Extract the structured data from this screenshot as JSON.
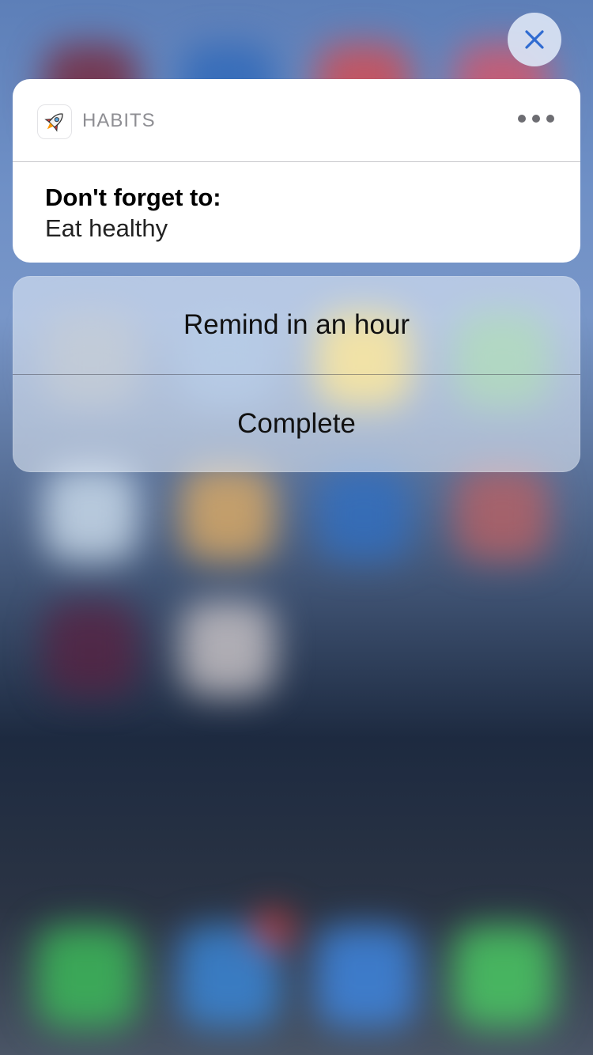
{
  "notification": {
    "app_name": "HABITS",
    "app_icon": "rocket-icon",
    "title": "Don't forget to:",
    "message": "Eat healthy"
  },
  "actions": [
    {
      "label": "Remind in an hour"
    },
    {
      "label": "Complete"
    }
  ],
  "controls": {
    "close_icon": "close-icon",
    "more_icon": "ellipsis-icon"
  },
  "colors": {
    "accent": "#2f6bd1",
    "close_bg": "#dae4f4",
    "card_bg": "#ffffff"
  }
}
